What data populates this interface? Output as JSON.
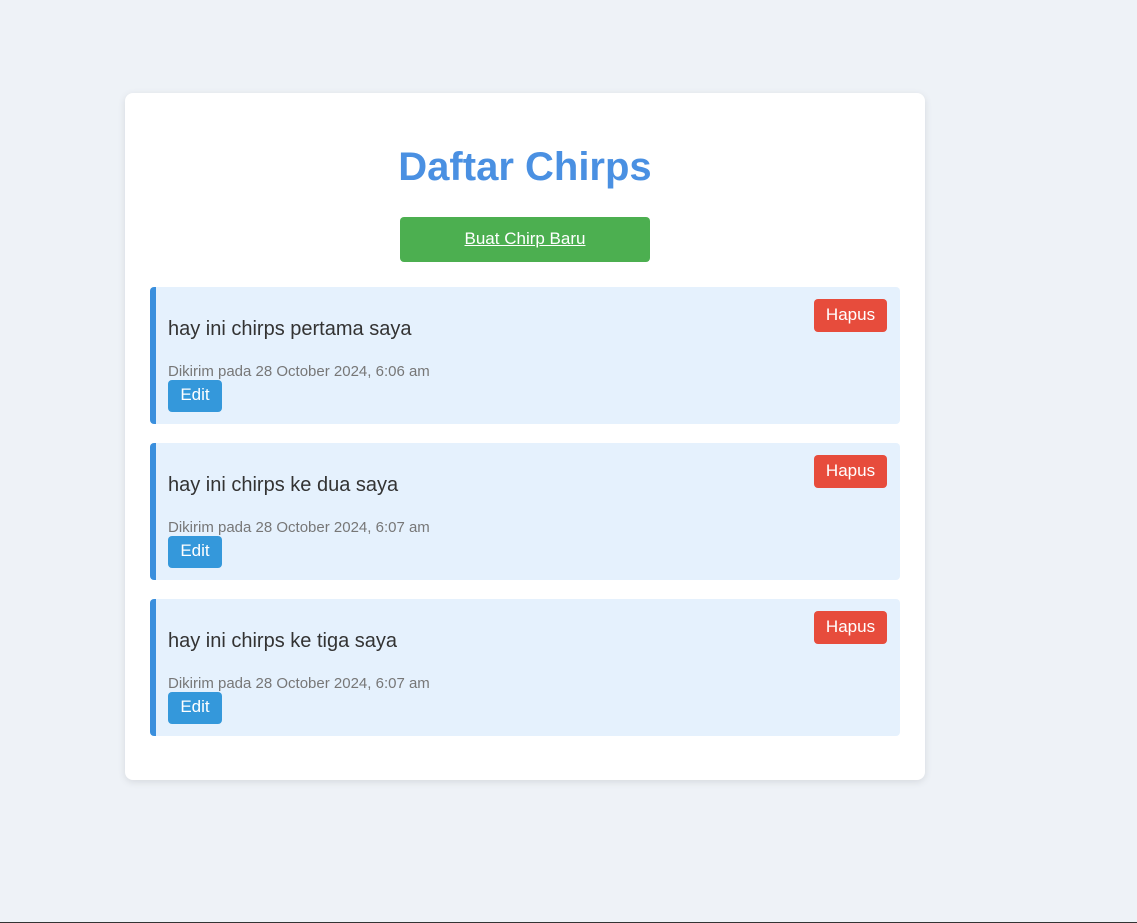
{
  "page": {
    "title": "Daftar Chirps",
    "create_button_label": "Buat Chirp Baru"
  },
  "chirps": [
    {
      "message": "hay ini chirps pertama saya",
      "meta": "Dikirim pada 28 October 2024, 6:06 am",
      "edit_label": "Edit",
      "delete_label": "Hapus"
    },
    {
      "message": "hay ini chirps ke dua saya",
      "meta": "Dikirim pada 28 October 2024, 6:07 am",
      "edit_label": "Edit",
      "delete_label": "Hapus"
    },
    {
      "message": "hay ini chirps ke tiga saya",
      "meta": "Dikirim pada 28 October 2024, 6:07 am",
      "edit_label": "Edit",
      "delete_label": "Hapus"
    }
  ],
  "colors": {
    "title": "#4a90e2",
    "create_button": "#4caf50",
    "chirp_background": "#e5f1fd",
    "chirp_accent": "#3a8fdd",
    "edit_button": "#3498db",
    "delete_button": "#e74c3c"
  }
}
